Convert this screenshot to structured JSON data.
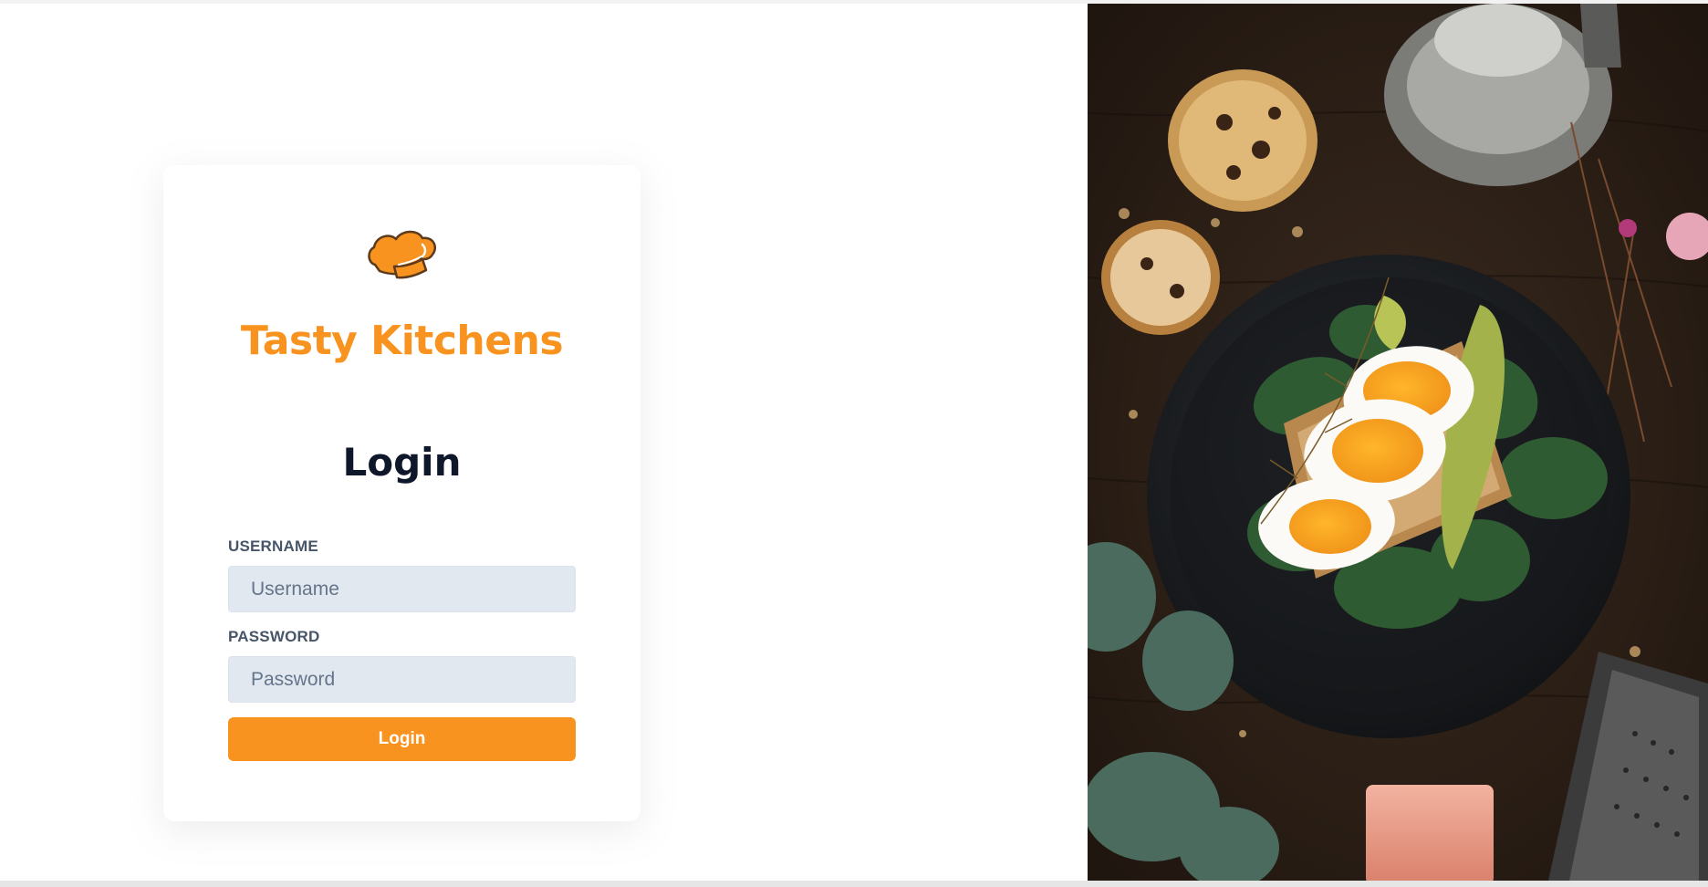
{
  "brand": {
    "name": "Tasty Kitchens",
    "logo_icon": "chef-hat-icon",
    "color": "#f7931e"
  },
  "login": {
    "heading": "Login",
    "username_label": "USERNAME",
    "username_placeholder": "Username",
    "username_value": "",
    "password_label": "PASSWORD",
    "password_placeholder": "Password",
    "password_value": "",
    "button_label": "Login",
    "button_color": "#f7931e",
    "input_bg": "#e2e8f0"
  },
  "hero": {
    "subject": "egg-avocado-toast-photo"
  }
}
